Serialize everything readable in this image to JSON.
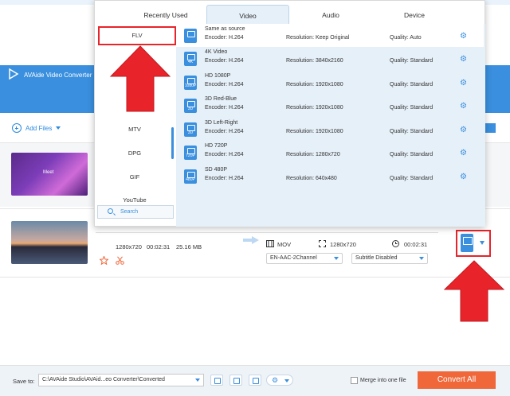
{
  "app": {
    "title": "AVAide Video Converter (",
    "add_files_label": "Add Files"
  },
  "files": [
    {
      "thumb_text": "Meet"
    },
    {
      "resolution": "1280x720",
      "duration": "00:02:31",
      "size": "25.16 MB",
      "output_format": "MOV",
      "output_resolution": "1280x720",
      "output_duration": "00:02:31",
      "audio_track": "EN-AAC-2Channel",
      "subtitle": "Subtitle Disabled"
    }
  ],
  "format_panel": {
    "tabs": [
      {
        "label": "Recently Used"
      },
      {
        "label": "Video"
      },
      {
        "label": "Audio"
      },
      {
        "label": "Device"
      }
    ],
    "active_tab": "Video",
    "formats": [
      {
        "label": "FLV"
      },
      {
        "label": "MTV"
      },
      {
        "label": "DPG"
      },
      {
        "label": "GIF"
      },
      {
        "label": "YouTube"
      }
    ],
    "search_placeholder": "Search",
    "presets": [
      {
        "name": "Same as source",
        "encoder": "Encoder: H.264",
        "resolution": "Resolution: Keep Original",
        "quality": "Quality: Auto",
        "badge": ""
      },
      {
        "name": "4K Video",
        "encoder": "Encoder: H.264",
        "resolution": "Resolution: 3840x2160",
        "quality": "Quality: Standard",
        "badge": "4K"
      },
      {
        "name": "HD 1080P",
        "encoder": "Encoder: H.264",
        "resolution": "Resolution: 1920x1080",
        "quality": "Quality: Standard",
        "badge": "1080P"
      },
      {
        "name": "3D Red-Blue",
        "encoder": "Encoder: H.264",
        "resolution": "Resolution: 1920x1080",
        "quality": "Quality: Standard",
        "badge": "3D"
      },
      {
        "name": "3D Left-Right",
        "encoder": "Encoder: H.264",
        "resolution": "Resolution: 1920x1080",
        "quality": "Quality: Standard",
        "badge": "3D"
      },
      {
        "name": "HD 720P",
        "encoder": "Encoder: H.264",
        "resolution": "Resolution: 1280x720",
        "quality": "Quality: Standard",
        "badge": "720P"
      },
      {
        "name": "SD 480P",
        "encoder": "Encoder: H.264",
        "resolution": "Resolution: 640x480",
        "quality": "Quality: Standard",
        "badge": "480P"
      }
    ]
  },
  "bottom": {
    "save_to_label": "Save to:",
    "save_path": "C:\\AVAide Studio\\AVAid...eo Converter\\Converted",
    "merge_label": "Merge into one file",
    "convert_all_label": "Convert All"
  },
  "colors": {
    "accent": "#3a8fde",
    "highlight_red": "#e8242a",
    "convert_orange": "#f0683a",
    "panel_bg": "#e6f0f8"
  }
}
